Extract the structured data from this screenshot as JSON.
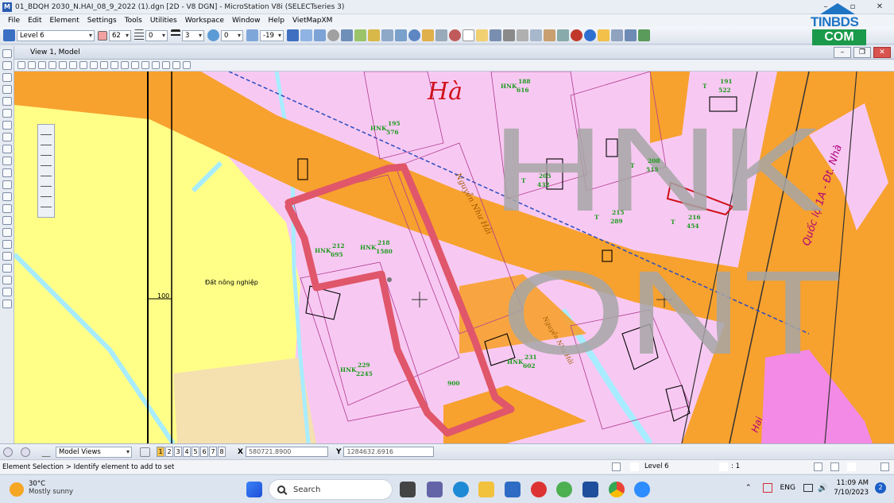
{
  "window": {
    "title": "01_BDQH 2030_N.HAI_08_9_2022 (1).dgn [2D - V8 DGN] - MicroStation V8i (SELECTseries 3)",
    "controls": [
      "–",
      "▫",
      "✕"
    ]
  },
  "logo": {
    "line1": "TINBDS",
    "line2": "COM"
  },
  "menu": [
    "File",
    "Edit",
    "Element",
    "Settings",
    "Tools",
    "Utilities",
    "Workspace",
    "Window",
    "Help",
    "VietMapXM"
  ],
  "attributes": {
    "level": "Level 6",
    "color": "62",
    "style": "0",
    "weight": "3",
    "transparency": "0",
    "priority": "-19",
    "color_swatch": "#f2a0a0"
  },
  "view": {
    "title": "View 1, Model",
    "controls": [
      "–",
      "❐",
      "✕"
    ]
  },
  "map": {
    "town_label": "Hà",
    "watermark_line1": "HNK",
    "watermark_line2": "ONT",
    "farmland_label": "Đất nông nghiệp",
    "road_label": "Nguyễn Như Hải",
    "road_label_lower": "Nguyễn Như Hải",
    "highway_label": "Quốc lộ 1A - Đt. Nhà",
    "grid_value": "100",
    "edge_text": "Hai",
    "parcels": [
      {
        "code": "HNK",
        "num": "212",
        "area": "695"
      },
      {
        "code": "HNK",
        "num": "218",
        "area": "1580"
      },
      {
        "code": "HNK",
        "num": "229",
        "area": "2245"
      },
      {
        "code": "HNK",
        "num": "231",
        "area": "602"
      },
      {
        "code": "HNK",
        "num": "195",
        "area": "576"
      },
      {
        "code": "HNK",
        "num": "188",
        "area": "616"
      },
      {
        "code": "T",
        "num": "216",
        "area": "454"
      },
      {
        "code": "T",
        "num": "208",
        "area": "515"
      },
      {
        "code": "T",
        "num": "215",
        "area": "289"
      },
      {
        "code": "T",
        "num": "191",
        "area": "522"
      },
      {
        "code": "",
        "num": "900",
        "area": ""
      },
      {
        "code": "T",
        "num": "205",
        "area": "432"
      }
    ],
    "colors": {
      "residential": "#f7c9f2",
      "agricultural": "#ffff88",
      "road": "#f7a12e",
      "boundary": "#e0566a",
      "water": "#a8ecff"
    }
  },
  "bottom": {
    "model_views": "Model Views",
    "view_numbers": [
      "1",
      "2",
      "3",
      "4",
      "5",
      "6",
      "7",
      "8"
    ],
    "x_label": "X",
    "x_value": "580721.8900",
    "y_label": "Y",
    "y_value": "1284632.6916"
  },
  "status": {
    "prompt": "Element Selection > Identify element to add to set",
    "level": "Level 6",
    "scale": ": 1"
  },
  "taskbar": {
    "temp": "30°C",
    "weather": "Mostly sunny",
    "search": "Search",
    "lang": "ENG",
    "time": "11:09 AM",
    "date": "7/10/2023",
    "notifications": "2"
  }
}
